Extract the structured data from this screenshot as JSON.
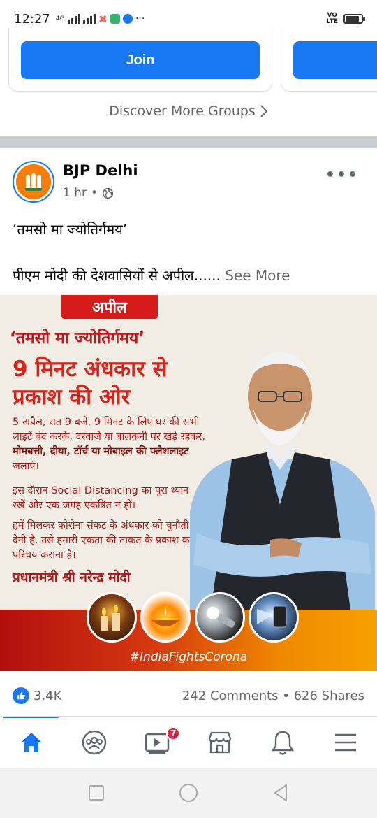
{
  "status_bar": {
    "time": "12:27",
    "network": "4G",
    "volte": "VO LTE",
    "battery_level": 0.85
  },
  "groups": {
    "join_label": "Join",
    "discover_label": "Discover More Groups"
  },
  "post": {
    "page_name": "BJP Delhi",
    "time_ago": "1 hr",
    "line1": "‘तमसो मा ज्योतिर्गमय’",
    "line2": "पीएम मोदी की देशवासियों से अपील......",
    "see_more": "See More",
    "image": {
      "tag": "अपील",
      "quote": "‘तमसो मा ज्योतिर्गमय’",
      "headline": "9 मिनट अंधकार से प्रकाश की ओर",
      "para1_a": "5 अप्रैल, रात 9 बजे, 9 मिनट के लिए घर की सभी लाइटें बंद करके, दरवाजे या बालकनी पर खड़े रहकर,",
      "para1_b": "मोमबत्ती, दीया, टॉर्च या मोबाइल की फ्लैशलाइट",
      "para1_c": "जलाएं।",
      "para2": "इस दौरान Social Distancing का पूरा ध्यान रखें और एक जगह एकत्रित न हों।",
      "para3": "हमें मिलकर कोरोना संकट के अंधकार को चुनौती देनी है, उसे हमारी एकता की ताकत के प्रकाश का परिचय कराना है।",
      "signature": "प्रधानमंत्री श्री नरेन्द्र मोदी",
      "hashtag": "#IndiaFightsCorona"
    },
    "likes": "3.4K",
    "comments_shares": "242 Comments • 626 Shares"
  },
  "nav": {
    "watch_badge": "7",
    "accent": "#1877f2"
  }
}
